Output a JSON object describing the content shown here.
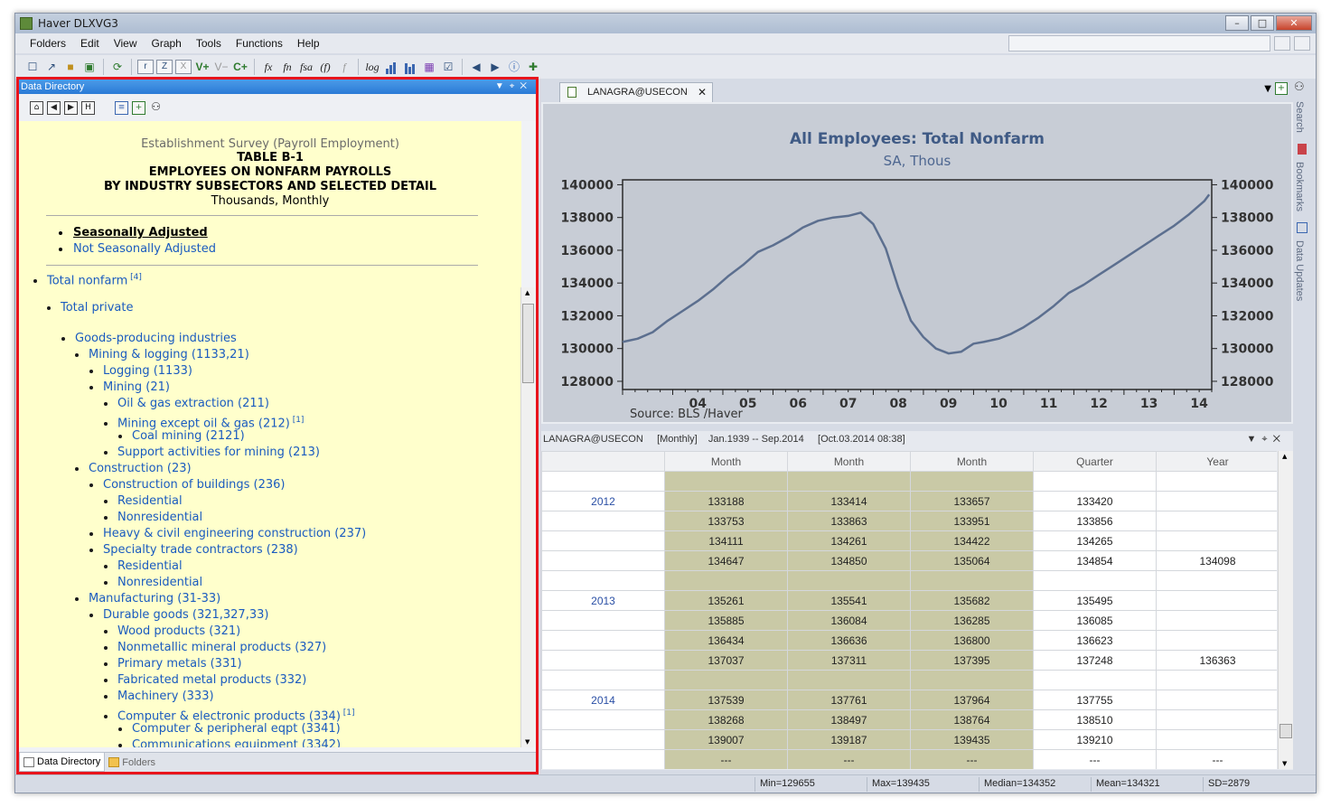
{
  "window": {
    "title": "Haver DLXVG3"
  },
  "menu": [
    "Folders",
    "Edit",
    "View",
    "Graph",
    "Tools",
    "Functions",
    "Help"
  ],
  "toolbar": {
    "buttons": [
      "r",
      "Z",
      "X",
      "V+",
      "V−",
      "C+",
      "fx",
      "fn",
      "fsa",
      "(f)",
      "f",
      "log"
    ]
  },
  "left_panel": {
    "title": "Data Directory",
    "survey": "Establishment Survey (Payroll Employment)",
    "table_id": "TABLE B-1",
    "table_title1": "EMPLOYEES ON NONFARM PAYROLLS",
    "table_title2": "BY INDUSTRY SUBSECTORS AND SELECTED DETAIL",
    "units": "Thousands, Monthly",
    "adjust_selected": "Seasonally Adjusted",
    "adjust_other": "Not Seasonally Adjusted",
    "tree": [
      {
        "label": "Total nonfarm",
        "sup": "[4]",
        "level": 0
      },
      {
        "label": "Total private",
        "sup": "",
        "level": 1
      },
      {
        "label": "Goods-producing industries",
        "sup": "",
        "level": 2
      },
      {
        "label": "Mining & logging (1133,21)",
        "sup": "",
        "level": 3
      },
      {
        "label": "Logging (1133)",
        "sup": "",
        "level": 4
      },
      {
        "label": "Mining (21)",
        "sup": "",
        "level": 4
      },
      {
        "label": "Oil & gas extraction (211)",
        "sup": "",
        "level": 5
      },
      {
        "label": "Mining except oil & gas (212)",
        "sup": "[1]",
        "level": 5
      },
      {
        "label": "Coal mining (2121)",
        "sup": "",
        "level": 6
      },
      {
        "label": "Support activities for mining (213)",
        "sup": "",
        "level": 5
      },
      {
        "label": "Construction (23)",
        "sup": "",
        "level": 3
      },
      {
        "label": "Construction of buildings (236)",
        "sup": "",
        "level": 4
      },
      {
        "label": "Residential",
        "sup": "",
        "level": 5
      },
      {
        "label": "Nonresidential",
        "sup": "",
        "level": 5
      },
      {
        "label": "Heavy & civil engineering construction (237)",
        "sup": "",
        "level": 4
      },
      {
        "label": "Specialty trade contractors (238)",
        "sup": "",
        "level": 4
      },
      {
        "label": "Residential",
        "sup": "",
        "level": 5
      },
      {
        "label": "Nonresidential",
        "sup": "",
        "level": 5
      },
      {
        "label": "Manufacturing (31-33)",
        "sup": "",
        "level": 3
      },
      {
        "label": "Durable goods (321,327,33)",
        "sup": "",
        "level": 4
      },
      {
        "label": "Wood products (321)",
        "sup": "",
        "level": 5
      },
      {
        "label": "Nonmetallic mineral products (327)",
        "sup": "",
        "level": 5
      },
      {
        "label": "Primary metals (331)",
        "sup": "",
        "level": 5
      },
      {
        "label": "Fabricated metal products (332)",
        "sup": "",
        "level": 5
      },
      {
        "label": "Machinery (333)",
        "sup": "",
        "level": 5
      },
      {
        "label": "Computer & electronic products (334)",
        "sup": "[1]",
        "level": 5
      },
      {
        "label": "Computer & peripheral eqpt (3341)",
        "sup": "",
        "level": 6
      },
      {
        "label": "Communications equipment (3342)",
        "sup": "",
        "level": 6
      }
    ],
    "tabs": [
      "Data Directory",
      "Folders"
    ]
  },
  "chart_tab": "LANAGRA@USECON",
  "chart_data": {
    "type": "line",
    "title": "All Employees: Total Nonfarm",
    "subtitle": "SA, Thous",
    "source": "Source:  BLS /Haver",
    "x_tick_labels": [
      "04",
      "05",
      "06",
      "07",
      "08",
      "09",
      "10",
      "11",
      "12",
      "13",
      "14"
    ],
    "y_ticks": [
      128000,
      130000,
      132000,
      134000,
      136000,
      138000,
      140000
    ],
    "ylim": [
      127500,
      140300
    ],
    "xlim": [
      2003.0,
      2014.75
    ],
    "series": [
      {
        "x": [
          2003.0,
          2003.3,
          2003.6,
          2003.9,
          2004.2,
          2004.5,
          2004.8,
          2005.1,
          2005.4,
          2005.7,
          2006.0,
          2006.3,
          2006.6,
          2006.9,
          2007.2,
          2007.5,
          2007.75,
          2008.0,
          2008.25,
          2008.5,
          2008.75,
          2009.0,
          2009.25,
          2009.5,
          2009.75,
          2010.0,
          2010.2,
          2010.5,
          2010.75,
          2011.0,
          2011.3,
          2011.6,
          2011.9,
          2012.2,
          2012.5,
          2012.8,
          2013.1,
          2013.4,
          2013.7,
          2014.0,
          2014.3,
          2014.6,
          2014.7
        ],
        "values": [
          130400,
          130600,
          131000,
          131700,
          132300,
          132900,
          133600,
          134400,
          135100,
          135900,
          136300,
          136800,
          137400,
          137800,
          138000,
          138100,
          138300,
          137600,
          136100,
          133700,
          131700,
          130700,
          130000,
          129700,
          129800,
          130300,
          130400,
          130600,
          130900,
          131300,
          131900,
          132600,
          133400,
          133900,
          134500,
          135100,
          135700,
          136300,
          136900,
          137500,
          138200,
          139000,
          139400
        ]
      }
    ]
  },
  "grid_panel": {
    "header": "LANAGRA@USECON     [Monthly]    Jan.1939 -- Sep.2014     [Oct.03.2014 08:38]",
    "columns": [
      "",
      "Month",
      "Month",
      "Month",
      "Quarter",
      "Year"
    ],
    "rows": [
      [
        "",
        "",
        "",
        "",
        "",
        ""
      ],
      [
        "2012",
        "133188",
        "133414",
        "133657",
        "133420",
        ""
      ],
      [
        "",
        "133753",
        "133863",
        "133951",
        "133856",
        ""
      ],
      [
        "",
        "134111",
        "134261",
        "134422",
        "134265",
        ""
      ],
      [
        "",
        "134647",
        "134850",
        "135064",
        "134854",
        "134098"
      ],
      [
        "",
        "",
        "",
        "",
        "",
        ""
      ],
      [
        "2013",
        "135261",
        "135541",
        "135682",
        "135495",
        ""
      ],
      [
        "",
        "135885",
        "136084",
        "136285",
        "136085",
        ""
      ],
      [
        "",
        "136434",
        "136636",
        "136800",
        "136623",
        ""
      ],
      [
        "",
        "137037",
        "137311",
        "137395",
        "137248",
        "136363"
      ],
      [
        "",
        "",
        "",
        "",
        "",
        ""
      ],
      [
        "2014",
        "137539",
        "137761",
        "137964",
        "137755",
        ""
      ],
      [
        "",
        "138268",
        "138497",
        "138764",
        "138510",
        ""
      ],
      [
        "",
        "139007",
        "139187",
        "139435",
        "139210",
        ""
      ],
      [
        "",
        "---",
        "---",
        "---",
        "---",
        "---"
      ]
    ]
  },
  "side_tabs": [
    "Search",
    "Bookmarks",
    "Data Updates"
  ],
  "status": {
    "min": "Min=129655",
    "max": "Max=139435",
    "median": "Median=134352",
    "mean": "Mean=134321",
    "sd": "SD=2879"
  },
  "colors": {
    "accent_red": "#e8141c",
    "panel_yellow": "#ffffcc",
    "link_blue": "#1a5bbf",
    "line": "#5c6f8f",
    "month_cell": "#c9c9a6"
  }
}
